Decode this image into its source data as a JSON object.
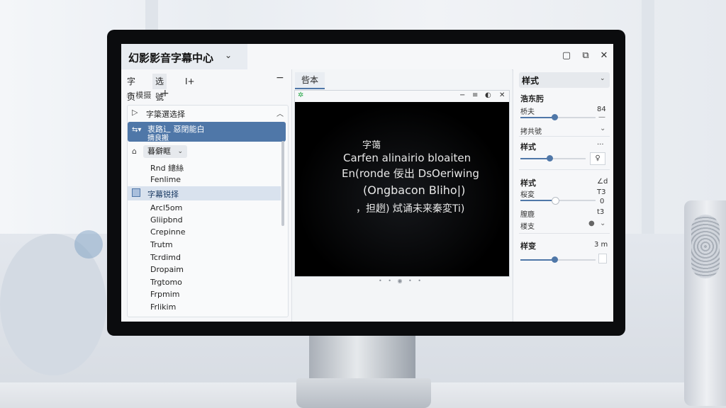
{
  "app": {
    "title": "幻影影音字幕中心",
    "title_chevron": "⌄",
    "window_controls": [
      "▢",
      "⧉",
      "✕"
    ]
  },
  "left_panel": {
    "tabs": [
      "字页",
      "选號",
      "I+"
    ],
    "collapse": "−",
    "subrow_label": "⎙ 模摄",
    "add": "+",
    "selector_header": "字簗選选择",
    "selected_item": {
      "line1": "衷路辶 惡閉能白",
      "line2": "摘良搬",
      "icon": "⇆▾"
    },
    "dropdown_label": "暮僻眶",
    "plain_items_top": [
      "Rnd 總絲",
      "Fenlime"
    ],
    "highlighted_item": "字幕锐择",
    "plain_items": [
      "Arcl5om",
      "Gliipbnd",
      "Crepinne",
      "Trutm",
      "Tcrdimd",
      "Dropaim",
      "Trgtomo",
      "Frpmim",
      "Frlikim"
    ]
  },
  "center_panel": {
    "tab": "呰本",
    "player_controls": [
      "−",
      "≡",
      "◐",
      "✕"
    ],
    "subtitle_lines": [
      "字蔼",
      "Carfen alinairio bloaiten",
      "En(ronde 佞出 DsOeriwing",
      "(Ongbacon Bliho|)",
      "，担趔) 烒诵未来秦変Ti)"
    ],
    "pager_dots": "• • ◉ • •"
  },
  "right_panel": {
    "header": "样式",
    "sec1_title": "浩东肟",
    "sec1_row1_label": "桥夫",
    "sec1_row1_value": "84",
    "sec1_slider": 0.45,
    "sec1_row2_label": "拷共號",
    "sec2_title": "样式",
    "sec2_more": "···",
    "sec2_slider": 0.45,
    "sec2_box": "♀",
    "sec3_title": "样式",
    "sec3_a": "∠d",
    "sec3_row1_label": "桜変",
    "sec3_row1_value": "T3",
    "sec3_slider": 0.45,
    "sec3_slider_end": "0",
    "sec3_row2_label": "膣鹿",
    "sec3_row2_value": "t3",
    "sec3_row3_label": "楼支",
    "sec4_title": "样变",
    "sec4_value": "3 m",
    "sec4_slider": 0.45
  }
}
